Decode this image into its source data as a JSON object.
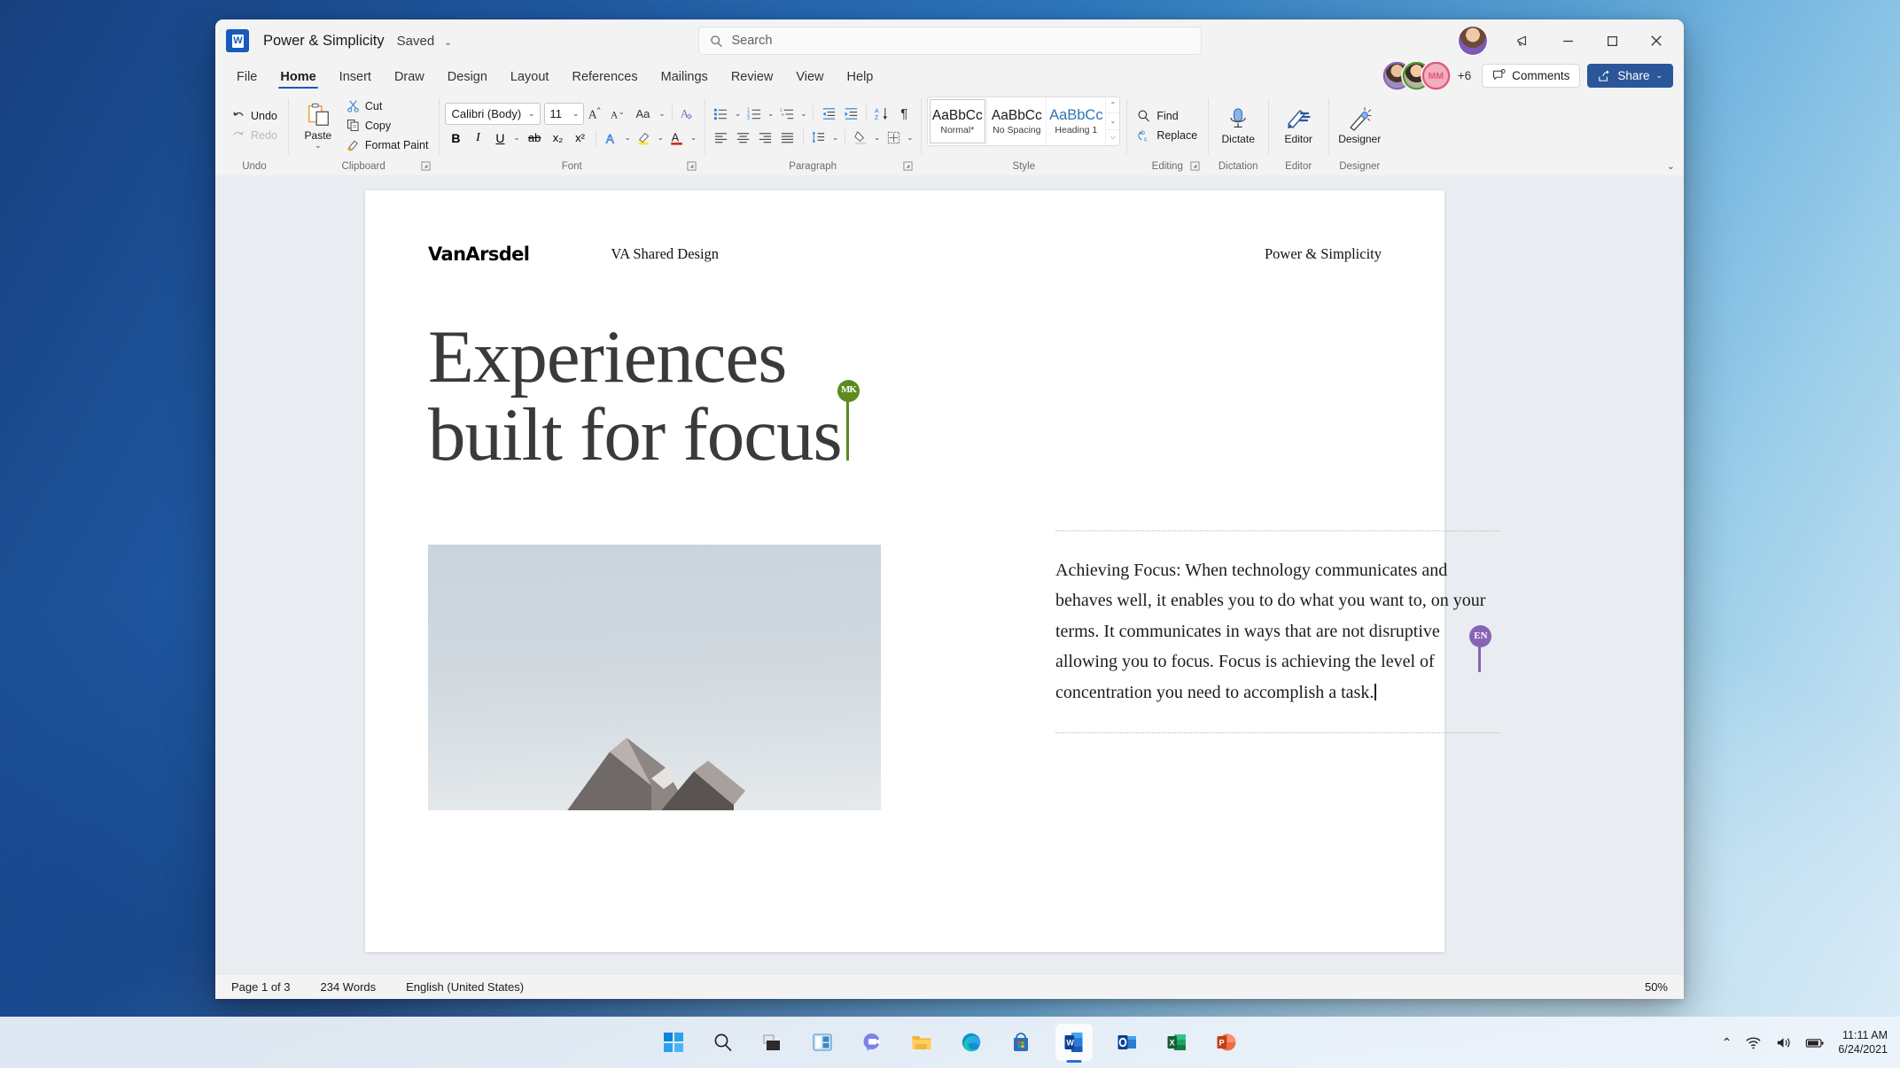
{
  "window": {
    "app": "word",
    "doc_title": "Power & Simplicity",
    "save_state": "Saved",
    "save_chevron": "⌄",
    "word_logo_letter": "W"
  },
  "search": {
    "placeholder": "Search",
    "value": "",
    "icon": "search-icon"
  },
  "title_buttons": {
    "notify": "megaphone-icon",
    "minimize": "minimize-icon",
    "maximize": "maximize-icon",
    "close": "close-icon"
  },
  "ribbon": {
    "tabs": [
      {
        "label": "File",
        "active": false
      },
      {
        "label": "Home",
        "active": true
      },
      {
        "label": "Insert",
        "active": false
      },
      {
        "label": "Draw",
        "active": false
      },
      {
        "label": "Design",
        "active": false
      },
      {
        "label": "Layout",
        "active": false
      },
      {
        "label": "References",
        "active": false
      },
      {
        "label": "Mailings",
        "active": false
      },
      {
        "label": "Review",
        "active": false
      },
      {
        "label": "View",
        "active": false
      },
      {
        "label": "Help",
        "active": false
      }
    ],
    "collaborators": [
      {
        "initials": "",
        "ring": "#8764b8",
        "fill": "#8a6a52"
      },
      {
        "initials": "",
        "ring": "#4f9b2f",
        "fill": "#5a4436"
      },
      {
        "initials": "MM",
        "ring": "#e3567a",
        "fill": "#f0a7b9"
      }
    ],
    "overflow_count": "+6",
    "comments_label": "Comments",
    "share_label": "Share",
    "share_chevron": "⌄",
    "collapse_icon": "chevron-up-icon",
    "groups": {
      "undo": {
        "label": "Undo",
        "undo_label": "Undo",
        "redo_label": "Redo"
      },
      "clipboard": {
        "label": "Clipboard",
        "paste_label": "Paste",
        "paste_chevron": "⌄",
        "cut_label": "Cut",
        "copy_label": "Copy",
        "format_painter_label": "Format Paint",
        "dialog_launcher": "dialog-launcher-icon"
      },
      "font": {
        "label": "Font",
        "font_name": "Calibri (Body)",
        "font_size": "11",
        "grow_font": "grow-font-icon",
        "shrink_font": "shrink-font-icon",
        "change_case": "Aa",
        "clear_formatting": "clear-formatting-icon",
        "bold": "B",
        "italic": "I",
        "underline": "U",
        "strikethrough": "ab",
        "subscript": "x₂",
        "superscript": "x²",
        "text_effects": "A",
        "highlight": "highlight-icon",
        "font_color": "A",
        "dialog_launcher": "dialog-launcher-icon"
      },
      "paragraph": {
        "label": "Paragraph",
        "bullets": "bullet-list-icon",
        "numbering": "numbered-list-icon",
        "multilevel": "multilevel-list-icon",
        "decrease_indent": "decrease-indent-icon",
        "increase_indent": "increase-indent-icon",
        "sort": "sort-icon",
        "show_marks": "¶",
        "align_left": "align-left-icon",
        "align_center": "align-center-icon",
        "align_right": "align-right-icon",
        "justify": "justify-icon",
        "line_spacing": "line-spacing-icon",
        "shading": "shading-icon",
        "borders": "borders-icon",
        "dialog_launcher": "dialog-launcher-icon"
      },
      "style": {
        "label": "Style",
        "cards": [
          {
            "preview": "AaBbCc",
            "name": "Normal*",
            "selected": true,
            "heading": false
          },
          {
            "preview": "AaBbCc",
            "name": "No Spacing",
            "selected": false,
            "heading": false
          },
          {
            "preview": "AaBbCc",
            "name": "Heading 1",
            "selected": false,
            "heading": true
          }
        ],
        "scroll_up": "⌃",
        "scroll_down": "⌄",
        "more": "⌵"
      },
      "editing": {
        "label": "Editing",
        "find_label": "Find",
        "replace_label": "Replace",
        "dialog_launcher": "dialog-launcher-icon"
      },
      "dictation": {
        "label": "Dictation",
        "button_label": "Dictate",
        "icon": "microphone-icon"
      },
      "editor": {
        "label": "Editor",
        "button_label": "Editor",
        "icon": "editor-pen-icon"
      },
      "designer": {
        "label": "Designer",
        "button_label": "Designer",
        "icon": "designer-wand-icon"
      }
    }
  },
  "document": {
    "header_logo": "VanArsdel",
    "header_center": "VA Shared Design",
    "header_right": "Power & Simplicity",
    "headline_line1": "Experiences",
    "headline_line2": "built for focus",
    "body_paragraph": "Achieving Focus: When technology communicates and behaves well, it enables you to do what you want to, on your terms. It communicates in ways that are not disruptive allowing you to focus. Focus is achieving the level of concentration you need to accomplish a task.",
    "image_alt": "building-rooftops-photo",
    "cursors": [
      {
        "initials": "MK",
        "color": "#5c8a1e",
        "where": "headline"
      },
      {
        "initials": "EN",
        "color": "#8764b8",
        "where": "paragraph"
      }
    ]
  },
  "statusbar": {
    "page": "Page 1 of 3",
    "words": "234 Words",
    "language": "English (United States)",
    "zoom": "50%"
  },
  "taskbar": {
    "items": [
      {
        "name": "start-button",
        "icon": "windows-logo"
      },
      {
        "name": "search-button",
        "icon": "search-glass"
      },
      {
        "name": "task-view-button",
        "icon": "task-view"
      },
      {
        "name": "widgets-button",
        "icon": "widgets"
      },
      {
        "name": "teams-chat-button",
        "icon": "teams-chat"
      },
      {
        "name": "file-explorer-button",
        "icon": "folder"
      },
      {
        "name": "edge-button",
        "icon": "edge"
      },
      {
        "name": "store-button",
        "icon": "store"
      },
      {
        "name": "word-button",
        "icon": "word",
        "active": true
      },
      {
        "name": "outlook-button",
        "icon": "outlook"
      },
      {
        "name": "excel-button",
        "icon": "excel"
      },
      {
        "name": "powerpoint-button",
        "icon": "powerpoint"
      }
    ],
    "tray": {
      "overflow": "⌃",
      "wifi": "wifi-icon",
      "volume": "volume-icon",
      "battery": "battery-icon",
      "time": "11:11 AM",
      "date": "6/24/2021"
    }
  }
}
